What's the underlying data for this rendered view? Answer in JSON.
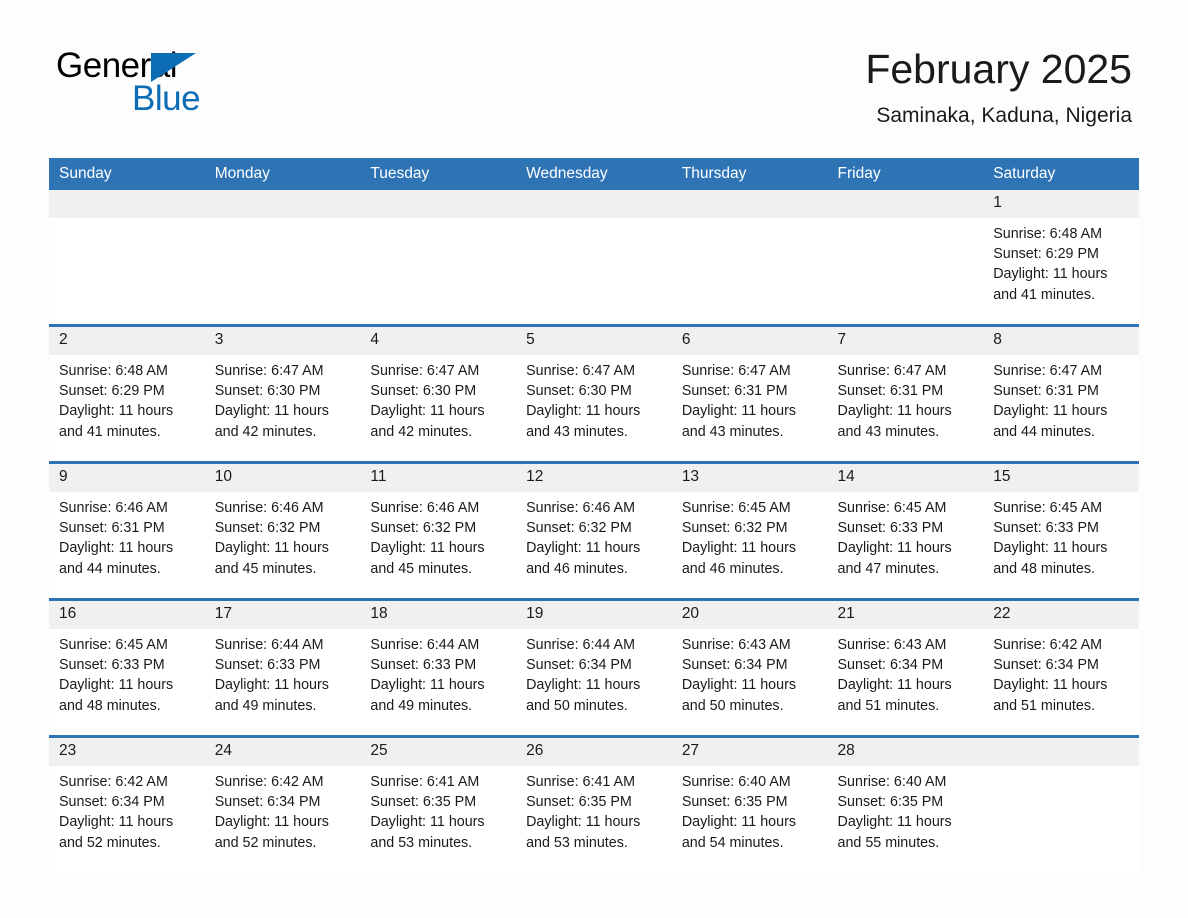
{
  "brand": {
    "line1": "General",
    "line2": "Blue",
    "triangle_color": "#0C6CB5"
  },
  "header": {
    "month_title": "February 2025",
    "location": "Saminaka, Kaduna, Nigeria",
    "accent_color": "#2E74B5",
    "day_band_color": "#F0F0F0"
  },
  "weekdays": [
    "Sunday",
    "Monday",
    "Tuesday",
    "Wednesday",
    "Thursday",
    "Friday",
    "Saturday"
  ],
  "labels": {
    "sunrise_prefix": "Sunrise:",
    "sunset_prefix": "Sunset:",
    "daylight_prefix": "Daylight:"
  },
  "weeks": [
    [
      {
        "day": "",
        "blank": true
      },
      {
        "day": "",
        "blank": true
      },
      {
        "day": "",
        "blank": true
      },
      {
        "day": "",
        "blank": true
      },
      {
        "day": "",
        "blank": true
      },
      {
        "day": "",
        "blank": true
      },
      {
        "day": "1",
        "sunrise": "Sunrise: 6:48 AM",
        "sunset": "Sunset: 6:29 PM",
        "daylight_line1": "Daylight: 11 hours",
        "daylight_line2": "and 41 minutes."
      }
    ],
    [
      {
        "day": "2",
        "sunrise": "Sunrise: 6:48 AM",
        "sunset": "Sunset: 6:29 PM",
        "daylight_line1": "Daylight: 11 hours",
        "daylight_line2": "and 41 minutes."
      },
      {
        "day": "3",
        "sunrise": "Sunrise: 6:47 AM",
        "sunset": "Sunset: 6:30 PM",
        "daylight_line1": "Daylight: 11 hours",
        "daylight_line2": "and 42 minutes."
      },
      {
        "day": "4",
        "sunrise": "Sunrise: 6:47 AM",
        "sunset": "Sunset: 6:30 PM",
        "daylight_line1": "Daylight: 11 hours",
        "daylight_line2": "and 42 minutes."
      },
      {
        "day": "5",
        "sunrise": "Sunrise: 6:47 AM",
        "sunset": "Sunset: 6:30 PM",
        "daylight_line1": "Daylight: 11 hours",
        "daylight_line2": "and 43 minutes."
      },
      {
        "day": "6",
        "sunrise": "Sunrise: 6:47 AM",
        "sunset": "Sunset: 6:31 PM",
        "daylight_line1": "Daylight: 11 hours",
        "daylight_line2": "and 43 minutes."
      },
      {
        "day": "7",
        "sunrise": "Sunrise: 6:47 AM",
        "sunset": "Sunset: 6:31 PM",
        "daylight_line1": "Daylight: 11 hours",
        "daylight_line2": "and 43 minutes."
      },
      {
        "day": "8",
        "sunrise": "Sunrise: 6:47 AM",
        "sunset": "Sunset: 6:31 PM",
        "daylight_line1": "Daylight: 11 hours",
        "daylight_line2": "and 44 minutes."
      }
    ],
    [
      {
        "day": "9",
        "sunrise": "Sunrise: 6:46 AM",
        "sunset": "Sunset: 6:31 PM",
        "daylight_line1": "Daylight: 11 hours",
        "daylight_line2": "and 44 minutes."
      },
      {
        "day": "10",
        "sunrise": "Sunrise: 6:46 AM",
        "sunset": "Sunset: 6:32 PM",
        "daylight_line1": "Daylight: 11 hours",
        "daylight_line2": "and 45 minutes."
      },
      {
        "day": "11",
        "sunrise": "Sunrise: 6:46 AM",
        "sunset": "Sunset: 6:32 PM",
        "daylight_line1": "Daylight: 11 hours",
        "daylight_line2": "and 45 minutes."
      },
      {
        "day": "12",
        "sunrise": "Sunrise: 6:46 AM",
        "sunset": "Sunset: 6:32 PM",
        "daylight_line1": "Daylight: 11 hours",
        "daylight_line2": "and 46 minutes."
      },
      {
        "day": "13",
        "sunrise": "Sunrise: 6:45 AM",
        "sunset": "Sunset: 6:32 PM",
        "daylight_line1": "Daylight: 11 hours",
        "daylight_line2": "and 46 minutes."
      },
      {
        "day": "14",
        "sunrise": "Sunrise: 6:45 AM",
        "sunset": "Sunset: 6:33 PM",
        "daylight_line1": "Daylight: 11 hours",
        "daylight_line2": "and 47 minutes."
      },
      {
        "day": "15",
        "sunrise": "Sunrise: 6:45 AM",
        "sunset": "Sunset: 6:33 PM",
        "daylight_line1": "Daylight: 11 hours",
        "daylight_line2": "and 48 minutes."
      }
    ],
    [
      {
        "day": "16",
        "sunrise": "Sunrise: 6:45 AM",
        "sunset": "Sunset: 6:33 PM",
        "daylight_line1": "Daylight: 11 hours",
        "daylight_line2": "and 48 minutes."
      },
      {
        "day": "17",
        "sunrise": "Sunrise: 6:44 AM",
        "sunset": "Sunset: 6:33 PM",
        "daylight_line1": "Daylight: 11 hours",
        "daylight_line2": "and 49 minutes."
      },
      {
        "day": "18",
        "sunrise": "Sunrise: 6:44 AM",
        "sunset": "Sunset: 6:33 PM",
        "daylight_line1": "Daylight: 11 hours",
        "daylight_line2": "and 49 minutes."
      },
      {
        "day": "19",
        "sunrise": "Sunrise: 6:44 AM",
        "sunset": "Sunset: 6:34 PM",
        "daylight_line1": "Daylight: 11 hours",
        "daylight_line2": "and 50 minutes."
      },
      {
        "day": "20",
        "sunrise": "Sunrise: 6:43 AM",
        "sunset": "Sunset: 6:34 PM",
        "daylight_line1": "Daylight: 11 hours",
        "daylight_line2": "and 50 minutes."
      },
      {
        "day": "21",
        "sunrise": "Sunrise: 6:43 AM",
        "sunset": "Sunset: 6:34 PM",
        "daylight_line1": "Daylight: 11 hours",
        "daylight_line2": "and 51 minutes."
      },
      {
        "day": "22",
        "sunrise": "Sunrise: 6:42 AM",
        "sunset": "Sunset: 6:34 PM",
        "daylight_line1": "Daylight: 11 hours",
        "daylight_line2": "and 51 minutes."
      }
    ],
    [
      {
        "day": "23",
        "sunrise": "Sunrise: 6:42 AM",
        "sunset": "Sunset: 6:34 PM",
        "daylight_line1": "Daylight: 11 hours",
        "daylight_line2": "and 52 minutes."
      },
      {
        "day": "24",
        "sunrise": "Sunrise: 6:42 AM",
        "sunset": "Sunset: 6:34 PM",
        "daylight_line1": "Daylight: 11 hours",
        "daylight_line2": "and 52 minutes."
      },
      {
        "day": "25",
        "sunrise": "Sunrise: 6:41 AM",
        "sunset": "Sunset: 6:35 PM",
        "daylight_line1": "Daylight: 11 hours",
        "daylight_line2": "and 53 minutes."
      },
      {
        "day": "26",
        "sunrise": "Sunrise: 6:41 AM",
        "sunset": "Sunset: 6:35 PM",
        "daylight_line1": "Daylight: 11 hours",
        "daylight_line2": "and 53 minutes."
      },
      {
        "day": "27",
        "sunrise": "Sunrise: 6:40 AM",
        "sunset": "Sunset: 6:35 PM",
        "daylight_line1": "Daylight: 11 hours",
        "daylight_line2": "and 54 minutes."
      },
      {
        "day": "28",
        "sunrise": "Sunrise: 6:40 AM",
        "sunset": "Sunset: 6:35 PM",
        "daylight_line1": "Daylight: 11 hours",
        "daylight_line2": "and 55 minutes."
      },
      {
        "day": "",
        "blank": true
      }
    ]
  ]
}
